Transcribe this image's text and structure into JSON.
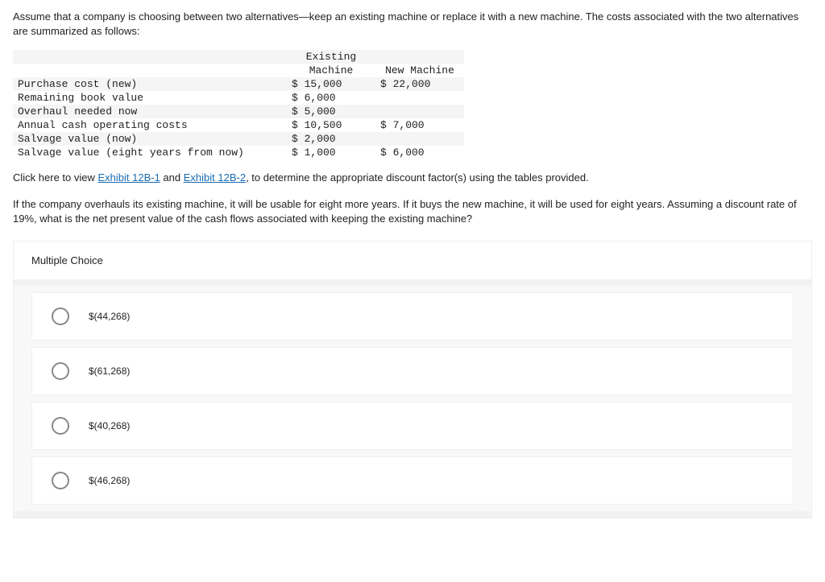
{
  "intro": "Assume that a company is choosing between two alternatives—keep an existing machine or replace it with a new machine. The costs associated with the two alternatives are summarized as follows:",
  "table": {
    "header_existing_1": "Existing",
    "header_existing_2": "Machine",
    "header_new": "New Machine",
    "rows": [
      {
        "label": "Purchase cost (new)",
        "existing": "$ 15,000",
        "newm": "$ 22,000"
      },
      {
        "label": "Remaining book value",
        "existing": "$ 6,000",
        "newm": ""
      },
      {
        "label": "Overhaul needed now",
        "existing": "$ 5,000",
        "newm": ""
      },
      {
        "label": "Annual cash operating costs",
        "existing": "$ 10,500",
        "newm": "$ 7,000"
      },
      {
        "label": "Salvage value (now)",
        "existing": "$ 2,000",
        "newm": ""
      },
      {
        "label": "Salvage value (eight years from now)",
        "existing": "$ 1,000",
        "newm": "$ 6,000"
      }
    ]
  },
  "link_line_pre": "Click here to view ",
  "link1": "Exhibit 12B-1",
  "link_and": " and ",
  "link2": "Exhibit 12B-2",
  "link_line_post": ", to determine the appropriate discount factor(s) using the tables provided.",
  "question": "If the company overhauls its existing machine, it will be usable for eight more years. If it buys the new machine, it will be used for eight years. Assuming a discount rate of 19%, what is the net present value of the cash flows associated with keeping the existing machine?",
  "mc_title": "Multiple Choice",
  "options": [
    "$(44,268)",
    "$(61,268)",
    "$(40,268)",
    "$(46,268)"
  ]
}
